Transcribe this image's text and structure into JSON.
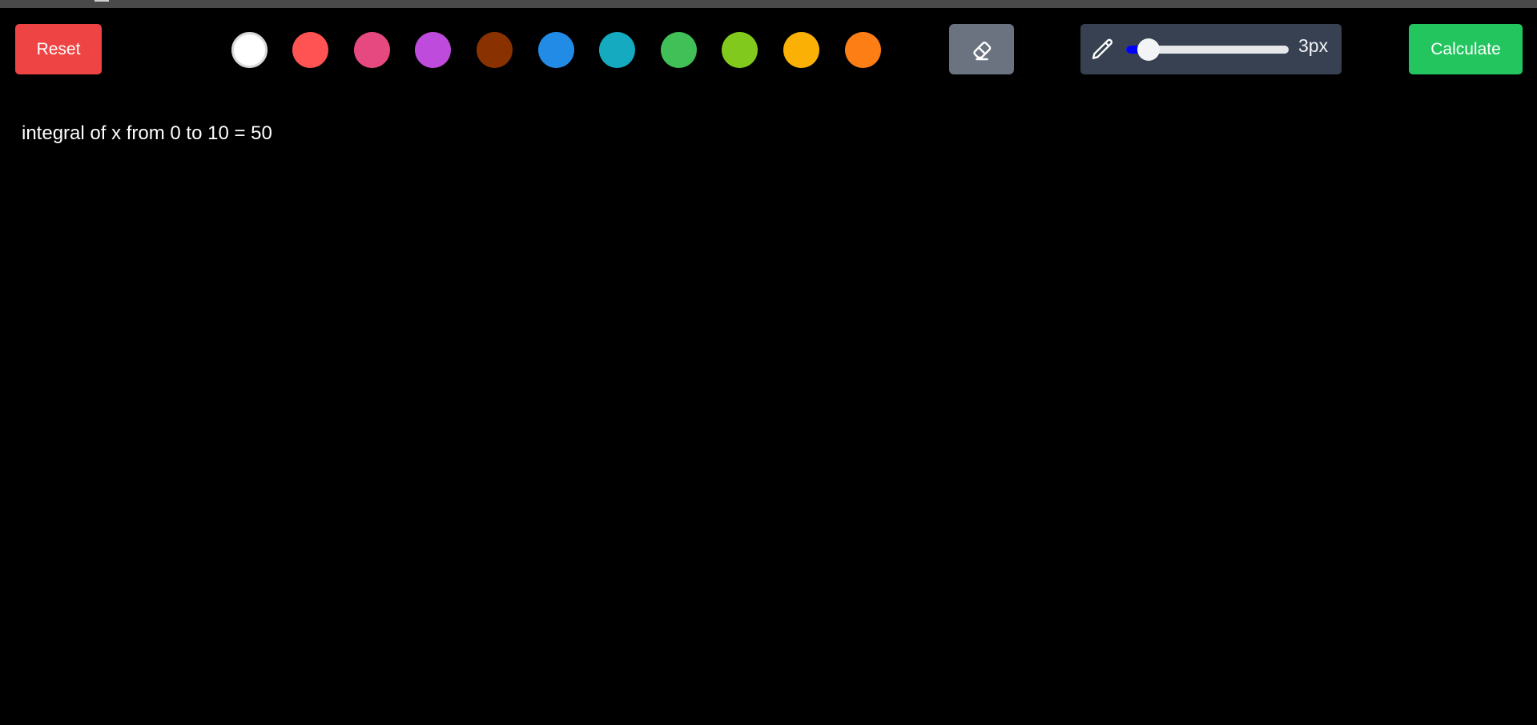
{
  "toolbar": {
    "reset_label": "Reset",
    "calculate_label": "Calculate",
    "colors": [
      {
        "name": "black",
        "hex": "#000000",
        "selected": false
      },
      {
        "name": "white",
        "hex": "#ffffff",
        "selected": true
      },
      {
        "name": "red",
        "hex": "#ff5252"
      },
      {
        "name": "pink",
        "hex": "#e64980"
      },
      {
        "name": "purple",
        "hex": "#be4bdb"
      },
      {
        "name": "brown",
        "hex": "#893200"
      },
      {
        "name": "blue",
        "hex": "#228be6"
      },
      {
        "name": "teal",
        "hex": "#15aabf"
      },
      {
        "name": "green",
        "hex": "#40c057"
      },
      {
        "name": "lime",
        "hex": "#82c91e"
      },
      {
        "name": "yellow",
        "hex": "#fab005"
      },
      {
        "name": "orange",
        "hex": "#fd7e14"
      }
    ],
    "eraser_icon": "eraser-icon",
    "brush": {
      "icon": "pencil-icon",
      "size_label": "3px",
      "size_fraction": 0.14
    }
  },
  "canvas": {
    "result_text": "integral of x from 0 to 10 = 50"
  },
  "theme": {
    "reset_color": "#ef4444",
    "calculate_color": "#22c55e",
    "slider_fill_color": "#0000ff"
  }
}
